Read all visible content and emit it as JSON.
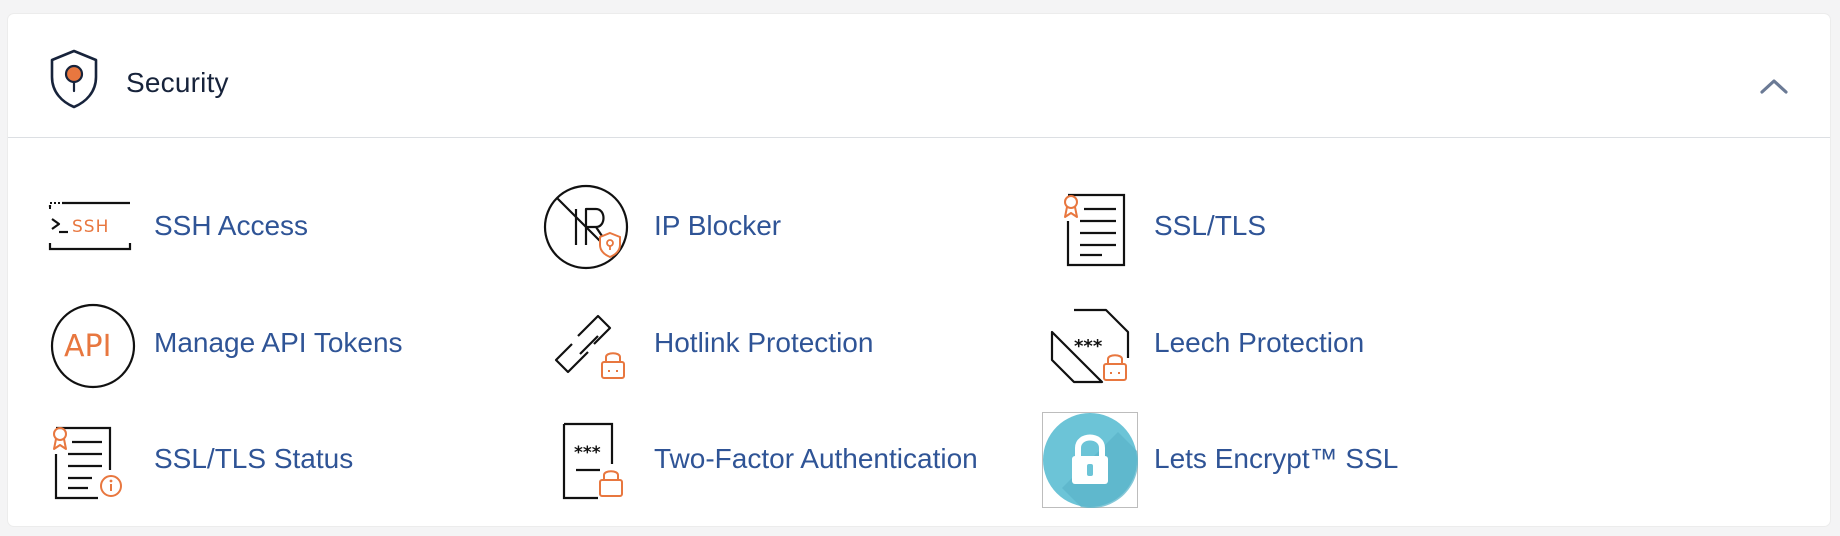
{
  "section": {
    "title": "Security",
    "icon": "shield-pin-icon",
    "collapse_icon": "chevron-up-icon"
  },
  "colors": {
    "accent_orange": "#e8773f",
    "link_blue": "#2f5496",
    "heading_dark": "#17233b",
    "icon_black": "#111111",
    "letsencrypt_teal": "#6cc4d7"
  },
  "items": [
    {
      "label": "SSH Access",
      "icon": "ssh-terminal-icon"
    },
    {
      "label": "IP Blocker",
      "icon": "ip-blocker-icon"
    },
    {
      "label": "SSL/TLS",
      "icon": "ssl-certificate-icon"
    },
    {
      "label": "Manage API Tokens",
      "icon": "api-tokens-icon"
    },
    {
      "label": "Hotlink Protection",
      "icon": "hotlink-chain-lock-icon"
    },
    {
      "label": "Leech Protection",
      "icon": "leech-octagon-lock-icon"
    },
    {
      "label": "SSL/TLS Status",
      "icon": "ssl-status-info-icon"
    },
    {
      "label": "Two-Factor Authentication",
      "icon": "two-factor-password-lock-icon"
    },
    {
      "label": "Lets Encrypt™ SSL",
      "icon": "lets-encrypt-padlock-icon"
    }
  ]
}
